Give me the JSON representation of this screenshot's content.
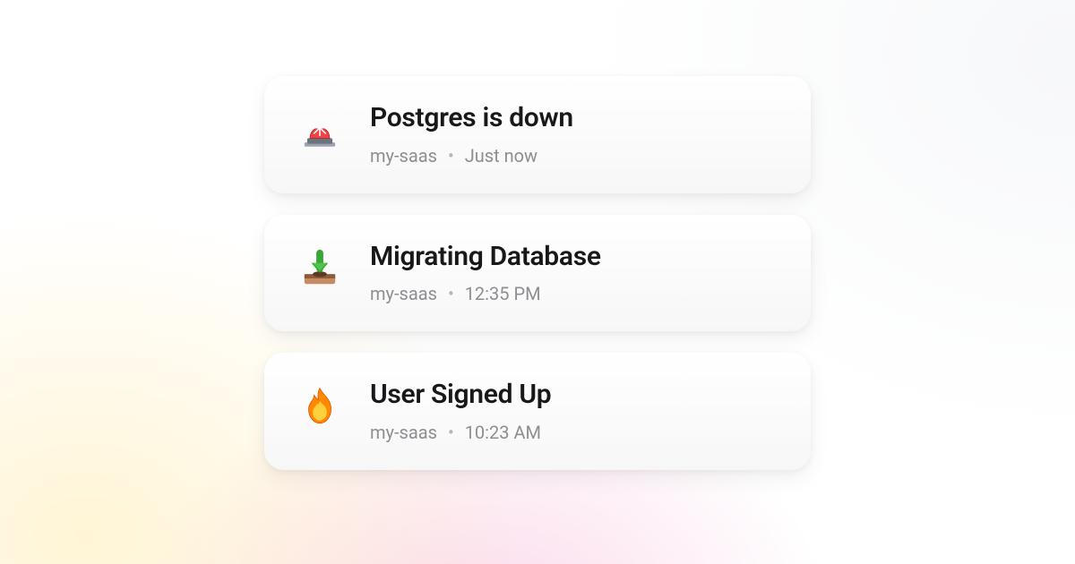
{
  "notifications": [
    {
      "icon_name": "siren-icon",
      "title": "Postgres is down",
      "project": "my-saas",
      "time": "Just now"
    },
    {
      "icon_name": "download-tray-icon",
      "title": "Migrating Database",
      "project": "my-saas",
      "time": "12:35 PM"
    },
    {
      "icon_name": "fire-icon",
      "title": "User Signed Up",
      "project": "my-saas",
      "time": "10:23 AM"
    }
  ],
  "separator_glyph": "•"
}
